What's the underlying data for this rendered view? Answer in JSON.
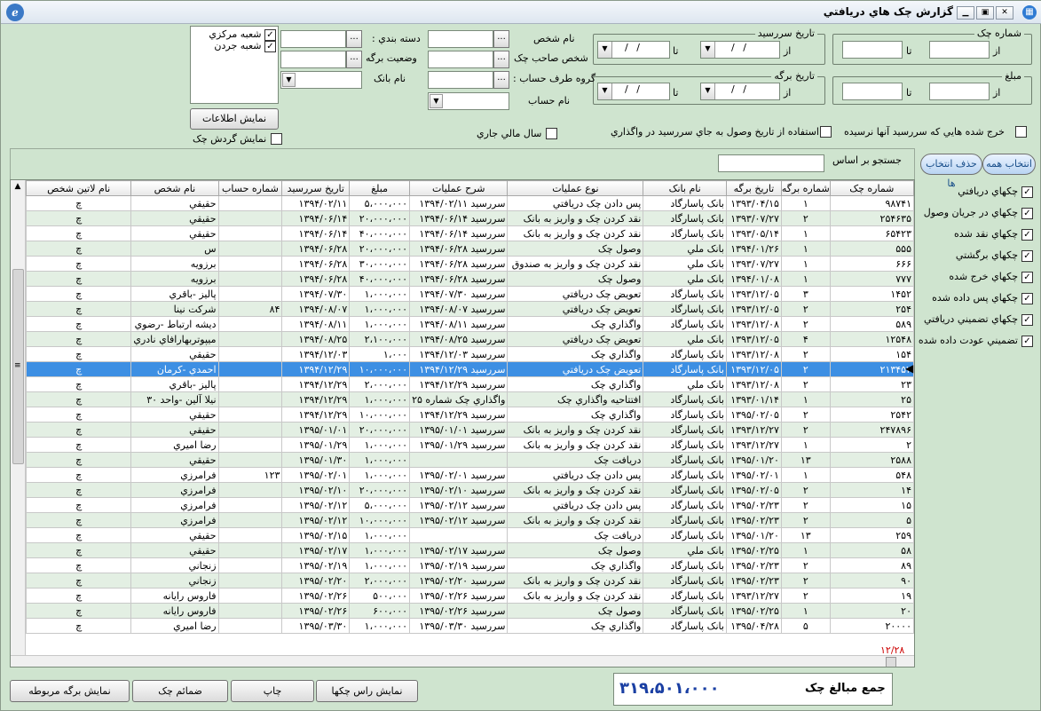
{
  "window": {
    "title": "گزارش چک هاي دريافتي",
    "logo": "ℯ",
    "icon": "windows-icon"
  },
  "filters": {
    "check_no_group": "شماره چک",
    "amount_group": "مبلغ",
    "due_group": "تاريخ سررسيد",
    "sheet_group": "تاريخ برگه",
    "from": "از",
    "to": "تا",
    "date_placeholder": "/ /",
    "person_name": "نام شخص",
    "check_owner": "شخص صاحب چک",
    "counterparty_group": "گروه طرف حساب :",
    "account_name": "نام حساب",
    "category": "دسته بندي :",
    "sheet_status": "وضعيت برگه",
    "bank_name": "نام بانک",
    "branches": [
      "شعبه مرکزي",
      "شعبه جردن"
    ],
    "show_info": "نمايش اطلاعات",
    "show_check_flow": "نمايش گردش چک",
    "fiscal_year": "سال مالي جاري",
    "use_receive_date": "استفاده از تاريخ وصول به جاي سررسيد در واگذاري",
    "spent_unmatured": "خرج شده هايي که سررسيد آنها نرسيده"
  },
  "search": {
    "label": "جستجو بر اساس",
    "value": ""
  },
  "right_buttons": {
    "select_all": "انتخاب همه",
    "deselect": "حذف انتخاب ها"
  },
  "right_filters": [
    "چکهاي دريافتي",
    "چکهاي در جريان وصول",
    "چکهاي نقد شده",
    "چکهاي برگشتي",
    "چکهاي خرج شده",
    "چکهاي پس داده شده",
    "چکهاي تضميني دريافتي",
    "تضميني عودت داده شده"
  ],
  "grid": {
    "columns": [
      "شماره چک",
      "شماره برگه",
      "تاريخ برگه",
      "نام بانک",
      "نوع عمليات",
      "شرح عمليات",
      "مبلغ",
      "تاريخ سررسيد",
      "شماره حساب",
      "نام شخص",
      "نام لاتين شخص"
    ],
    "rows": [
      [
        "۹۸۷۴۱",
        "۱",
        "۱۳۹۳/۰۴/۱۵",
        "بانک پاسارگاد",
        "پس دادن چک دريافتي",
        "سررسيد ۱۳۹۴/۰۲/۱۱",
        "۵،۰۰۰،۰۰۰",
        "۱۳۹۴/۰۲/۱۱",
        "",
        "حقيقي",
        "چ"
      ],
      [
        "۲۵۴۶۳۵",
        "۲",
        "۱۳۹۳/۰۷/۲۷",
        "بانک پاسارگاد",
        "نقد کردن چک و واريز به بانک",
        "سررسيد ۱۳۹۴/۰۶/۱۴",
        "۲۰،۰۰۰،۰۰۰",
        "۱۳۹۴/۰۶/۱۴",
        "",
        "حقيقي",
        "چ"
      ],
      [
        "۶۵۴۲۳",
        "۱",
        "۱۳۹۳/۰۵/۱۴",
        "بانک پاسارگاد",
        "نقد کردن چک و واريز به بانک",
        "سررسيد ۱۳۹۴/۰۶/۱۴",
        "۴۰،۰۰۰،۰۰۰",
        "۱۳۹۴/۰۶/۱۴",
        "",
        "حقيقي",
        "چ"
      ],
      [
        "۵۵۵",
        "۱",
        "۱۳۹۴/۰۱/۲۶",
        "بانک ملي",
        "وصول چک",
        "سررسيد ۱۳۹۴/۰۶/۲۸",
        "۲۰،۰۰۰،۰۰۰",
        "۱۳۹۴/۰۶/۲۸",
        "",
        "س",
        "چ"
      ],
      [
        "۶۶۶",
        "۱",
        "۱۳۹۳/۰۷/۲۷",
        "بانک ملي",
        "نقد کردن چک و واريز به صندوق",
        "سررسيد ۱۳۹۴/۰۶/۲۸",
        "۳۰،۰۰۰،۰۰۰",
        "۱۳۹۴/۰۶/۲۸",
        "",
        "برزويه",
        "چ"
      ],
      [
        "۷۷۷",
        "۱",
        "۱۳۹۴/۰۱/۰۸",
        "بانک ملي",
        "وصول چک",
        "سررسيد ۱۳۹۴/۰۶/۲۸",
        "۴۰،۰۰۰،۰۰۰",
        "۱۳۹۴/۰۶/۲۸",
        "",
        "برزويه",
        "چ"
      ],
      [
        "۱۴۵۲",
        "۳",
        "۱۳۹۳/۱۲/۰۵",
        "بانک پاسارگاد",
        "تعويض چک دريافتي",
        "سررسيد ۱۳۹۴/۰۷/۳۰",
        "۱،۰۰۰،۰۰۰",
        "۱۳۹۴/۰۷/۳۰",
        "",
        "پاليز -باقري",
        "چ"
      ],
      [
        "۲۵۴",
        "۲",
        "۱۳۹۳/۱۲/۰۵",
        "بانک پاسارگاد",
        "تعويض چک دريافتي",
        "سررسيد ۱۳۹۴/۰۸/۰۷",
        "۱،۰۰۰،۰۰۰",
        "۱۳۹۴/۰۸/۰۷",
        "۸۴",
        "شرکت نينا",
        "چ"
      ],
      [
        "۵۸۹",
        "۲",
        "۱۳۹۳/۱۲/۰۸",
        "بانک پاسارگاد",
        "واگذاري چک",
        "سررسيد ۱۳۹۴/۰۸/۱۱",
        "۱،۰۰۰،۰۰۰",
        "۱۳۹۴/۰۸/۱۱",
        "",
        "ديشه ارتباط -رضوي",
        "چ"
      ],
      [
        "۱۲۵۴۸",
        "۴",
        "۱۳۹۳/۱۲/۰۵",
        "بانک ملي",
        "تعويض چک دريافتي",
        "سررسيد ۱۳۹۴/۰۸/۲۵",
        "۲،۱۰۰،۰۰۰",
        "۱۳۹۴/۰۸/۲۵",
        "",
        "ميپوتربهارافاي نادري",
        "چ"
      ],
      [
        "۱۵۴",
        "۲",
        "۱۳۹۳/۱۲/۰۸",
        "بانک پاسارگاد",
        "واگذاري چک",
        "سررسيد ۱۳۹۴/۱۲/۰۳",
        "۱،۰۰۰",
        "۱۳۹۴/۱۲/۰۳",
        "",
        "حقيقي",
        "چ"
      ],
      [
        "۲۱۳۴۵۲",
        "۲",
        "۱۳۹۳/۱۲/۰۵",
        "بانک پاسارگاد",
        "تعويض چک دريافتي",
        "سررسيد ۱۳۹۴/۱۲/۲۹",
        "۱۰،۰۰۰،۰۰۰",
        "۱۳۹۴/۱۲/۲۹",
        "",
        "احمدي -کرمان",
        "چ"
      ],
      [
        "۲۳",
        "۲",
        "۱۳۹۳/۱۲/۰۸",
        "بانک ملي",
        "واگذاري چک",
        "سررسيد ۱۳۹۴/۱۲/۲۹",
        "۲،۰۰۰،۰۰۰",
        "۱۳۹۴/۱۲/۲۹",
        "",
        "پاليز -باقري",
        "چ"
      ],
      [
        "۲۵",
        "۱",
        "۱۳۹۳/۰۱/۱۴",
        "بانک پاسارگاد",
        "افتتاحيه واگذاري چک",
        "واگذاري چک شماره ۲۵",
        "۱،۰۰۰،۰۰۰",
        "۱۳۹۴/۱۲/۲۹",
        "",
        "نيلا آلين -واحد ۳۰",
        "چ"
      ],
      [
        "۲۵۴۲",
        "۲",
        "۱۳۹۵/۰۲/۰۵",
        "بانک پاسارگاد",
        "واگذاري چک",
        "سررسيد ۱۳۹۴/۱۲/۲۹",
        "۱۰،۰۰۰،۰۰۰",
        "۱۳۹۴/۱۲/۲۹",
        "",
        "حقيقي",
        "چ"
      ],
      [
        "۲۴۷۸۹۶",
        "۲",
        "۱۳۹۳/۱۲/۲۷",
        "بانک پاسارگاد",
        "نقد کردن چک و واريز به بانک",
        "سررسيد ۱۳۹۵/۰۱/۰۱",
        "۲۰،۰۰۰،۰۰۰",
        "۱۳۹۵/۰۱/۰۱",
        "",
        "حقيقي",
        "چ"
      ],
      [
        "۲",
        "۱",
        "۱۳۹۳/۱۲/۲۷",
        "بانک پاسارگاد",
        "نقد کردن چک و واريز به بانک",
        "سررسيد ۱۳۹۵/۰۱/۲۹",
        "۱،۰۰۰،۰۰۰",
        "۱۳۹۵/۰۱/۲۹",
        "",
        "رضا اميري",
        "چ"
      ],
      [
        "۲۵۸۸",
        "۱۳",
        "۱۳۹۵/۰۱/۲۰",
        "بانک پاسارگاد",
        "دريافت چک",
        "",
        "۱،۰۰۰،۰۰۰",
        "۱۳۹۵/۰۱/۳۰",
        "",
        "حقيقي",
        "چ"
      ],
      [
        "۵۴۸",
        "۱",
        "۱۳۹۵/۰۲/۰۱",
        "بانک پاسارگاد",
        "پس دادن چک دريافتي",
        "سررسيد ۱۳۹۵/۰۲/۰۱",
        "۱،۰۰۰،۰۰۰",
        "۱۳۹۵/۰۲/۰۱",
        "۱۲۳",
        "فرامرزي",
        "چ"
      ],
      [
        "۱۴",
        "۲",
        "۱۳۹۵/۰۲/۰۵",
        "بانک پاسارگاد",
        "نقد کردن چک و واريز به بانک",
        "سررسيد ۱۳۹۵/۰۲/۱۰",
        "۲۰،۰۰۰،۰۰۰",
        "۱۳۹۵/۰۲/۱۰",
        "",
        "فرامرزي",
        "چ"
      ],
      [
        "۱۵",
        "۲",
        "۱۳۹۵/۰۲/۲۳",
        "بانک پاسارگاد",
        "پس دادن چک دريافتي",
        "سررسيد ۱۳۹۵/۰۲/۱۲",
        "۵،۰۰۰،۰۰۰",
        "۱۳۹۵/۰۲/۱۲",
        "",
        "فرامرزي",
        "چ"
      ],
      [
        "۵",
        "۲",
        "۱۳۹۵/۰۲/۲۳",
        "بانک پاسارگاد",
        "نقد کردن چک و واريز به بانک",
        "سررسيد ۱۳۹۵/۰۲/۱۲",
        "۱۰،۰۰۰،۰۰۰",
        "۱۳۹۵/۰۲/۱۲",
        "",
        "فرامرزي",
        "چ"
      ],
      [
        "۲۵۹",
        "۱۳",
        "۱۳۹۵/۰۱/۲۰",
        "بانک پاسارگاد",
        "دريافت چک",
        "",
        "۱،۰۰۰،۰۰۰",
        "۱۳۹۵/۰۲/۱۵",
        "",
        "حقيقي",
        "چ"
      ],
      [
        "۵۸",
        "۱",
        "۱۳۹۵/۰۲/۲۵",
        "بانک ملي",
        "وصول چک",
        "سررسيد ۱۳۹۵/۰۲/۱۷",
        "۱،۰۰۰،۰۰۰",
        "۱۳۹۵/۰۲/۱۷",
        "",
        "حقيقي",
        "چ"
      ],
      [
        "۸۹",
        "۲",
        "۱۳۹۵/۰۲/۲۳",
        "بانک پاسارگاد",
        "واگذاري چک",
        "سررسيد ۱۳۹۵/۰۲/۱۹",
        "۱،۰۰۰،۰۰۰",
        "۱۳۹۵/۰۲/۱۹",
        "",
        "زنجاني",
        "چ"
      ],
      [
        "۹۰",
        "۲",
        "۱۳۹۵/۰۲/۲۳",
        "بانک پاسارگاد",
        "نقد کردن چک و واريز به بانک",
        "سررسيد ۱۳۹۵/۰۲/۲۰",
        "۲،۰۰۰،۰۰۰",
        "۱۳۹۵/۰۲/۲۰",
        "",
        "زنجاني",
        "چ"
      ],
      [
        "۱۹",
        "۲",
        "۱۳۹۳/۱۲/۲۷",
        "بانک پاسارگاد",
        "نقد کردن چک و واريز به بانک",
        "سررسيد ۱۳۹۵/۰۲/۲۶",
        "۵۰۰،۰۰۰",
        "۱۳۹۵/۰۲/۲۶",
        "",
        "فاروس رايانه",
        "چ"
      ],
      [
        "۲۰",
        "۱",
        "۱۳۹۵/۰۲/۲۵",
        "بانک پاسارگاد",
        "وصول چک",
        "سررسيد ۱۳۹۵/۰۲/۲۶",
        "۶۰۰،۰۰۰",
        "۱۳۹۵/۰۲/۲۶",
        "",
        "فاروس رايانه",
        "چ"
      ],
      [
        "۲۰۰۰۰",
        "۵",
        "۱۳۹۵/۰۴/۲۸",
        "بانک پاسارگاد",
        "واگذاري چک",
        "سررسيد ۱۳۹۵/۰۳/۳۰",
        "۱،۰۰۰،۰۰۰",
        "۱۳۹۵/۰۳/۳۰",
        "",
        "رضا اميري",
        "چ"
      ]
    ],
    "selected_index": 11,
    "record_counter": "۱۲/۲۸"
  },
  "total": {
    "label": "جمع مبالغ چک",
    "value": "۳۱۹،۵۰۱،۰۰۰"
  },
  "bottom_buttons": [
    "نمايش برگه مربوطه",
    "ضمائم چک",
    "چاپ",
    "نمايش راس چکها"
  ]
}
